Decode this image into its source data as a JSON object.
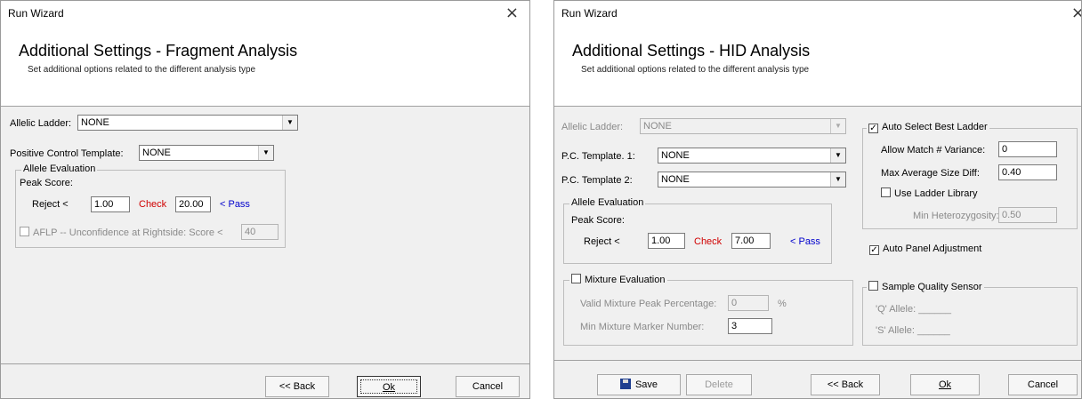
{
  "left": {
    "title": "Run Wizard",
    "close_icon": "×",
    "heading": "Additional Settings - Fragment Analysis",
    "subheading": "Set additional options related to the different analysis type",
    "allelic_ladder_label": "Allelic Ladder:",
    "allelic_ladder_value": "NONE",
    "pc_template_label": "Positive Control Template:",
    "pc_template_value": "NONE",
    "allele_eval_legend": "Allele Evaluation",
    "peak_score_label": "Peak Score:",
    "reject_label": "Reject <",
    "reject_value": "1.00",
    "check_label": "Check",
    "check_value": "20.00",
    "pass_label": "< Pass",
    "aflp_label": "AFLP -- Unconfidence at Rightside:  Score <",
    "aflp_value": "40",
    "back_label": "<< Back",
    "ok_label": "Ok",
    "cancel_label": "Cancel"
  },
  "right": {
    "title": "Run Wizard",
    "close_icon": "×",
    "heading": "Additional Settings - HID Analysis",
    "subheading": "Set additional options related to the different analysis type",
    "allelic_ladder_label": "Allelic Ladder:",
    "allelic_ladder_value": "NONE",
    "pc1_label": "P.C. Template. 1:",
    "pc1_value": "NONE",
    "pc2_label": "P.C. Template 2:",
    "pc2_value": "NONE",
    "allele_eval_legend": "Allele Evaluation",
    "peak_score_label": "Peak Score:",
    "reject_label": "Reject <",
    "reject_value": "1.00",
    "check_label": "Check",
    "check_value": "7.00",
    "pass_label": "< Pass",
    "mixture_legend": "Mixture Evaluation",
    "valid_mixture_label": "Valid Mixture Peak Percentage:",
    "valid_mixture_value": "0",
    "percent": "%",
    "min_mixture_label": "Min Mixture Marker Number:",
    "min_mixture_value": "3",
    "auto_select_legend": "Auto Select Best Ladder",
    "allow_match_label": "Allow Match # Variance:",
    "allow_match_value": "0",
    "max_avg_label": "Max Average Size Diff:",
    "max_avg_value": "0.40",
    "use_ladder_label": "Use Ladder Library",
    "min_het_label": "Min Heterozygosity:",
    "min_het_value": "0.50",
    "auto_panel_label": "Auto Panel Adjustment",
    "sample_quality_legend": "Sample Quality Sensor",
    "q_allele_label": "'Q' Allele:",
    "s_allele_label": "'S' Allele:",
    "save_label": "Save",
    "delete_label": "Delete",
    "back_label": "<< Back",
    "ok_label": "Ok",
    "cancel_label": "Cancel"
  }
}
